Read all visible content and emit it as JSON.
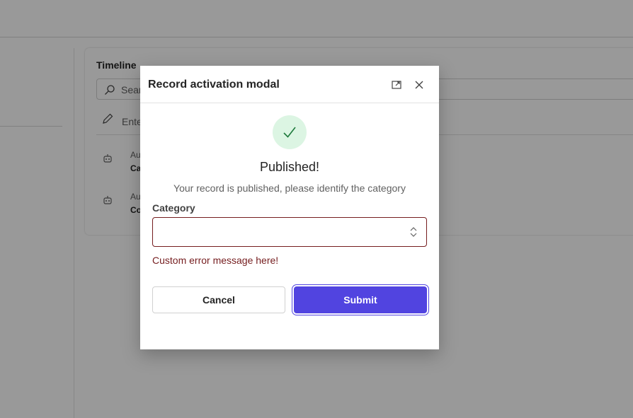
{
  "background": {
    "timeline": {
      "title": "Timeline",
      "search_placeholder": "Sear",
      "note_placeholder": "Ente",
      "items": [
        {
          "line1": "Au",
          "line2": "Ca"
        },
        {
          "line1": "Au",
          "line2": "Co"
        }
      ]
    }
  },
  "modal": {
    "title": "Record activation modal",
    "heading": "Published!",
    "subtext": "Your record is published, please identify the category",
    "category_label": "Category",
    "category_value": "",
    "error_message": "Custom error message here!",
    "cancel_label": "Cancel",
    "submit_label": "Submit",
    "icons": {
      "expand": "expand-icon",
      "close": "close-icon",
      "success": "checkmark-icon",
      "select": "chevron-up-down-icon"
    }
  },
  "colors": {
    "accent": "#5144e0",
    "error": "#751d1f",
    "success_bg": "#dcf5e3",
    "success_check": "#1e7a3c",
    "overlay": "rgba(0,0,0,0.4)"
  }
}
